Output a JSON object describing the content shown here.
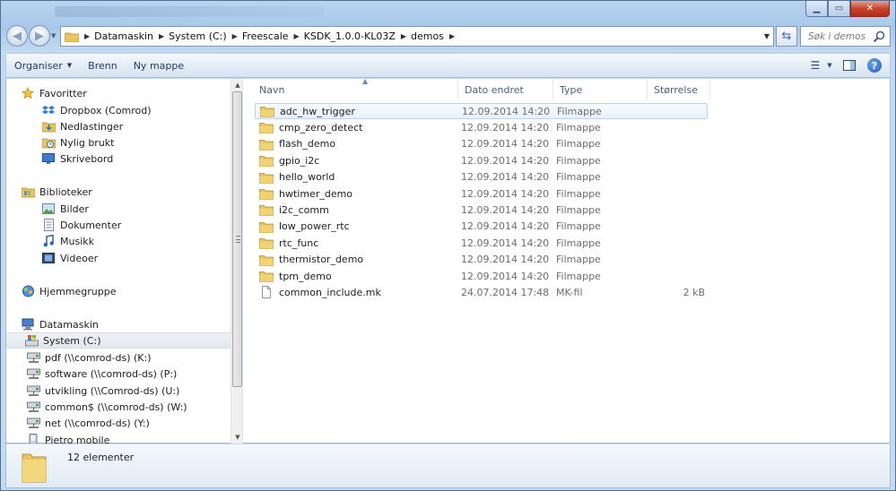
{
  "address": {
    "breadcrumbs": [
      "Datamaskin",
      "System (C:)",
      "Freescale",
      "KSDK_1.0.0-KL03Z",
      "demos"
    ]
  },
  "search": {
    "placeholder": "Søk i demos"
  },
  "toolbar": {
    "organize_label": "Organiser",
    "burn_label": "Brenn",
    "new_folder_label": "Ny mappe"
  },
  "nav": {
    "favorites_label": "Favoritter",
    "dropbox": "Dropbox (Comrod)",
    "downloads": "Nedlastinger",
    "recent": "Nylig brukt",
    "desktop": "Skrivebord",
    "libraries_label": "Biblioteker",
    "pictures": "Bilder",
    "documents": "Dokumenter",
    "music": "Musikk",
    "videos": "Videoer",
    "homegroup": "Hjemmegruppe",
    "computer": "Datamaskin",
    "system_c": "System (C:)",
    "pdf_k": "pdf (\\\\comrod-ds) (K:)",
    "software_p": "software (\\\\comrod-ds) (P:)",
    "utvikling_u": "utvikling (\\\\Comrod-ds) (U:)",
    "common_w": "common$ (\\\\comrod-ds) (W:)",
    "net_y": "net (\\\\comrod-ds) (Y:)",
    "pietro": "Pietro mobile"
  },
  "columns": {
    "name": "Navn",
    "date": "Dato endret",
    "type": "Type",
    "size": "Størrelse"
  },
  "files": [
    {
      "name": "adc_hw_trigger",
      "date": "12.09.2014 14:20",
      "type": "Filmappe",
      "size": ""
    },
    {
      "name": "cmp_zero_detect",
      "date": "12.09.2014 14:20",
      "type": "Filmappe",
      "size": ""
    },
    {
      "name": "flash_demo",
      "date": "12.09.2014 14:20",
      "type": "Filmappe",
      "size": ""
    },
    {
      "name": "gpio_i2c",
      "date": "12.09.2014 14:20",
      "type": "Filmappe",
      "size": ""
    },
    {
      "name": "hello_world",
      "date": "12.09.2014 14:20",
      "type": "Filmappe",
      "size": ""
    },
    {
      "name": "hwtimer_demo",
      "date": "12.09.2014 14:20",
      "type": "Filmappe",
      "size": ""
    },
    {
      "name": "i2c_comm",
      "date": "12.09.2014 14:20",
      "type": "Filmappe",
      "size": ""
    },
    {
      "name": "low_power_rtc",
      "date": "12.09.2014 14:20",
      "type": "Filmappe",
      "size": ""
    },
    {
      "name": "rtc_func",
      "date": "12.09.2014 14:20",
      "type": "Filmappe",
      "size": ""
    },
    {
      "name": "thermistor_demo",
      "date": "12.09.2014 14:20",
      "type": "Filmappe",
      "size": ""
    },
    {
      "name": "tpm_demo",
      "date": "12.09.2014 14:20",
      "type": "Filmappe",
      "size": ""
    },
    {
      "name": "common_include.mk",
      "date": "24.07.2014 17:48",
      "type": "MK-fil",
      "size": "2 kB"
    }
  ],
  "details": {
    "count_text": "12 elementer"
  },
  "colors": {
    "folder": "#e8c560",
    "selection": "#e9f2fc",
    "accent": "#1e395b"
  }
}
